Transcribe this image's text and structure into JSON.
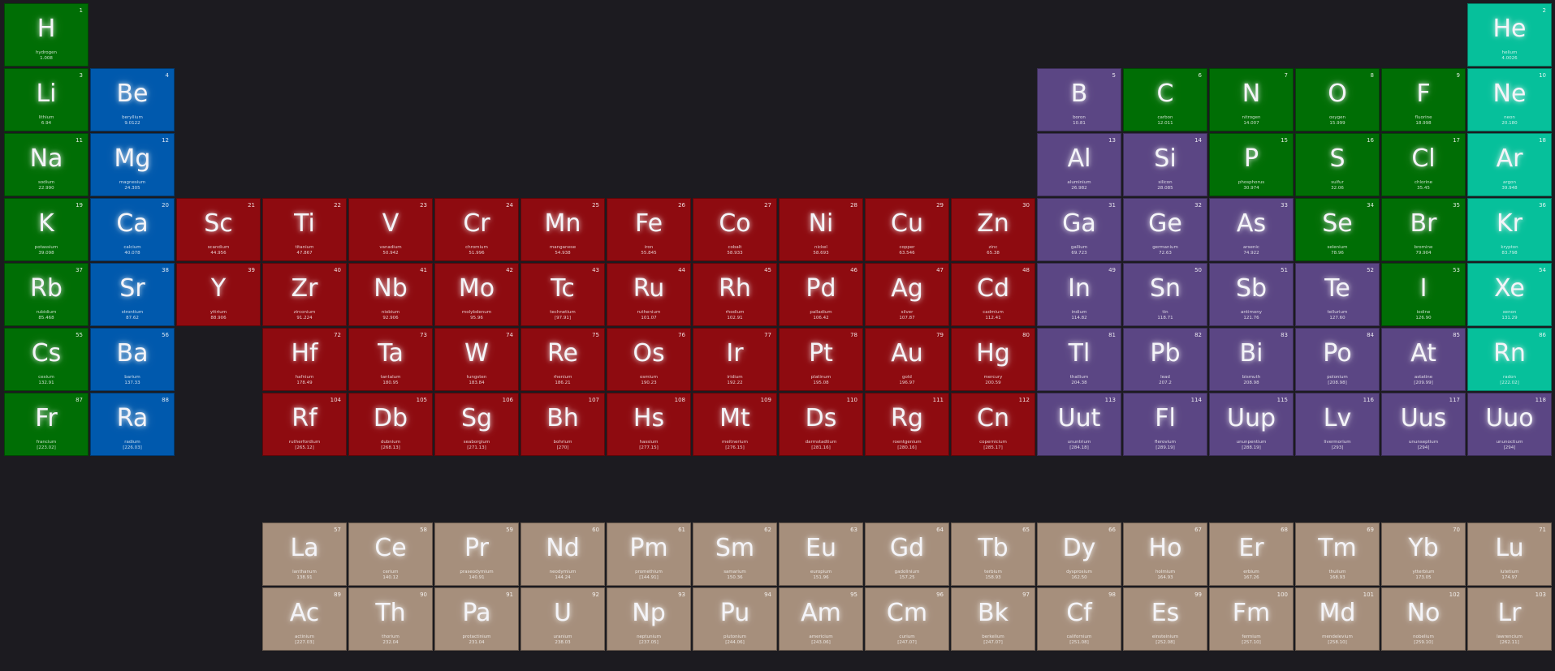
{
  "colors": {
    "background": "#1c1b20",
    "nonmetal": "#006e05",
    "alkaline-earth": "#0059ad",
    "transition": "#8e0b10",
    "metalloid": "#5b4684",
    "noble-gas": "#06c09b",
    "lanthanide": "#a68f7c",
    "actinide": "#a68f7c"
  },
  "elements": [
    {
      "n": "1",
      "sym": "H",
      "name": "hydrogen",
      "mass": "1.008",
      "cat": "nonmetal",
      "row": 1,
      "col": 1
    },
    {
      "n": "2",
      "sym": "He",
      "name": "helium",
      "mass": "4.0026",
      "cat": "noble-gas",
      "row": 1,
      "col": 18
    },
    {
      "n": "3",
      "sym": "Li",
      "name": "lithium",
      "mass": "6.94",
      "cat": "nonmetal",
      "row": 2,
      "col": 1
    },
    {
      "n": "4",
      "sym": "Be",
      "name": "beryllium",
      "mass": "9.0122",
      "cat": "alkaline-earth",
      "row": 2,
      "col": 2
    },
    {
      "n": "5",
      "sym": "B",
      "name": "boron",
      "mass": "10.81",
      "cat": "metalloid",
      "row": 2,
      "col": 13
    },
    {
      "n": "6",
      "sym": "C",
      "name": "carbon",
      "mass": "12.011",
      "cat": "nonmetal",
      "row": 2,
      "col": 14
    },
    {
      "n": "7",
      "sym": "N",
      "name": "nitrogen",
      "mass": "14.007",
      "cat": "nonmetal",
      "row": 2,
      "col": 15
    },
    {
      "n": "8",
      "sym": "O",
      "name": "oxygen",
      "mass": "15.999",
      "cat": "nonmetal",
      "row": 2,
      "col": 16
    },
    {
      "n": "9",
      "sym": "F",
      "name": "fluorine",
      "mass": "18.998",
      "cat": "nonmetal",
      "row": 2,
      "col": 17
    },
    {
      "n": "10",
      "sym": "Ne",
      "name": "neon",
      "mass": "20.180",
      "cat": "noble-gas",
      "row": 2,
      "col": 18
    },
    {
      "n": "11",
      "sym": "Na",
      "name": "sodium",
      "mass": "22.990",
      "cat": "nonmetal",
      "row": 3,
      "col": 1
    },
    {
      "n": "12",
      "sym": "Mg",
      "name": "magnesium",
      "mass": "24.305",
      "cat": "alkaline-earth",
      "row": 3,
      "col": 2
    },
    {
      "n": "13",
      "sym": "Al",
      "name": "aluminium",
      "mass": "26.982",
      "cat": "metalloid",
      "row": 3,
      "col": 13
    },
    {
      "n": "14",
      "sym": "Si",
      "name": "silicon",
      "mass": "28.085",
      "cat": "metalloid",
      "row": 3,
      "col": 14
    },
    {
      "n": "15",
      "sym": "P",
      "name": "phosphorus",
      "mass": "30.974",
      "cat": "nonmetal",
      "row": 3,
      "col": 15
    },
    {
      "n": "16",
      "sym": "S",
      "name": "sulfur",
      "mass": "32.06",
      "cat": "nonmetal",
      "row": 3,
      "col": 16
    },
    {
      "n": "17",
      "sym": "Cl",
      "name": "chlorine",
      "mass": "35.45",
      "cat": "nonmetal",
      "row": 3,
      "col": 17
    },
    {
      "n": "18",
      "sym": "Ar",
      "name": "argon",
      "mass": "39.948",
      "cat": "noble-gas",
      "row": 3,
      "col": 18
    },
    {
      "n": "19",
      "sym": "K",
      "name": "potassium",
      "mass": "39.098",
      "cat": "nonmetal",
      "row": 4,
      "col": 1
    },
    {
      "n": "20",
      "sym": "Ca",
      "name": "calcium",
      "mass": "40.078",
      "cat": "alkaline-earth",
      "row": 4,
      "col": 2
    },
    {
      "n": "21",
      "sym": "Sc",
      "name": "scandium",
      "mass": "44.956",
      "cat": "transition",
      "row": 4,
      "col": 3
    },
    {
      "n": "22",
      "sym": "Ti",
      "name": "titanium",
      "mass": "47.867",
      "cat": "transition",
      "row": 4,
      "col": 4
    },
    {
      "n": "23",
      "sym": "V",
      "name": "vanadium",
      "mass": "50.942",
      "cat": "transition",
      "row": 4,
      "col": 5
    },
    {
      "n": "24",
      "sym": "Cr",
      "name": "chromium",
      "mass": "51.996",
      "cat": "transition",
      "row": 4,
      "col": 6
    },
    {
      "n": "25",
      "sym": "Mn",
      "name": "manganese",
      "mass": "54.938",
      "cat": "transition",
      "row": 4,
      "col": 7
    },
    {
      "n": "26",
      "sym": "Fe",
      "name": "iron",
      "mass": "55.845",
      "cat": "transition",
      "row": 4,
      "col": 8
    },
    {
      "n": "27",
      "sym": "Co",
      "name": "cobalt",
      "mass": "58.933",
      "cat": "transition",
      "row": 4,
      "col": 9
    },
    {
      "n": "28",
      "sym": "Ni",
      "name": "nickel",
      "mass": "58.693",
      "cat": "transition",
      "row": 4,
      "col": 10
    },
    {
      "n": "29",
      "sym": "Cu",
      "name": "copper",
      "mass": "63.546",
      "cat": "transition",
      "row": 4,
      "col": 11
    },
    {
      "n": "30",
      "sym": "Zn",
      "name": "zinc",
      "mass": "65.38",
      "cat": "transition",
      "row": 4,
      "col": 12
    },
    {
      "n": "31",
      "sym": "Ga",
      "name": "gallium",
      "mass": "69.723",
      "cat": "metalloid",
      "row": 4,
      "col": 13
    },
    {
      "n": "32",
      "sym": "Ge",
      "name": "germanium",
      "mass": "72.63",
      "cat": "metalloid",
      "row": 4,
      "col": 14
    },
    {
      "n": "33",
      "sym": "As",
      "name": "arsenic",
      "mass": "74.922",
      "cat": "metalloid",
      "row": 4,
      "col": 15
    },
    {
      "n": "34",
      "sym": "Se",
      "name": "selenium",
      "mass": "78.96",
      "cat": "nonmetal",
      "row": 4,
      "col": 16
    },
    {
      "n": "35",
      "sym": "Br",
      "name": "bromine",
      "mass": "79.904",
      "cat": "nonmetal",
      "row": 4,
      "col": 17
    },
    {
      "n": "36",
      "sym": "Kr",
      "name": "krypton",
      "mass": "83.798",
      "cat": "noble-gas",
      "row": 4,
      "col": 18
    },
    {
      "n": "37",
      "sym": "Rb",
      "name": "rubidium",
      "mass": "85.468",
      "cat": "nonmetal",
      "row": 5,
      "col": 1
    },
    {
      "n": "38",
      "sym": "Sr",
      "name": "strontium",
      "mass": "87.62",
      "cat": "alkaline-earth",
      "row": 5,
      "col": 2
    },
    {
      "n": "39",
      "sym": "Y",
      "name": "yttrium",
      "mass": "88.906",
      "cat": "transition",
      "row": 5,
      "col": 3
    },
    {
      "n": "40",
      "sym": "Zr",
      "name": "zirconium",
      "mass": "91.224",
      "cat": "transition",
      "row": 5,
      "col": 4
    },
    {
      "n": "41",
      "sym": "Nb",
      "name": "niobium",
      "mass": "92.906",
      "cat": "transition",
      "row": 5,
      "col": 5
    },
    {
      "n": "42",
      "sym": "Mo",
      "name": "molybdenum",
      "mass": "95.96",
      "cat": "transition",
      "row": 5,
      "col": 6
    },
    {
      "n": "43",
      "sym": "Tc",
      "name": "technetium",
      "mass": "[97.91]",
      "cat": "transition",
      "row": 5,
      "col": 7
    },
    {
      "n": "44",
      "sym": "Ru",
      "name": "ruthenium",
      "mass": "101.07",
      "cat": "transition",
      "row": 5,
      "col": 8
    },
    {
      "n": "45",
      "sym": "Rh",
      "name": "rhodium",
      "mass": "102.91",
      "cat": "transition",
      "row": 5,
      "col": 9
    },
    {
      "n": "46",
      "sym": "Pd",
      "name": "palladium",
      "mass": "106.42",
      "cat": "transition",
      "row": 5,
      "col": 10
    },
    {
      "n": "47",
      "sym": "Ag",
      "name": "silver",
      "mass": "107.87",
      "cat": "transition",
      "row": 5,
      "col": 11
    },
    {
      "n": "48",
      "sym": "Cd",
      "name": "cadmium",
      "mass": "112.41",
      "cat": "transition",
      "row": 5,
      "col": 12
    },
    {
      "n": "49",
      "sym": "In",
      "name": "indium",
      "mass": "114.82",
      "cat": "metalloid",
      "row": 5,
      "col": 13
    },
    {
      "n": "50",
      "sym": "Sn",
      "name": "tin",
      "mass": "118.71",
      "cat": "metalloid",
      "row": 5,
      "col": 14
    },
    {
      "n": "51",
      "sym": "Sb",
      "name": "antimony",
      "mass": "121.76",
      "cat": "metalloid",
      "row": 5,
      "col": 15
    },
    {
      "n": "52",
      "sym": "Te",
      "name": "tellurium",
      "mass": "127.60",
      "cat": "metalloid",
      "row": 5,
      "col": 16
    },
    {
      "n": "53",
      "sym": "I",
      "name": "iodine",
      "mass": "126.90",
      "cat": "nonmetal",
      "row": 5,
      "col": 17
    },
    {
      "n": "54",
      "sym": "Xe",
      "name": "xenon",
      "mass": "131.29",
      "cat": "noble-gas",
      "row": 5,
      "col": 18
    },
    {
      "n": "55",
      "sym": "Cs",
      "name": "cesium",
      "mass": "132.91",
      "cat": "nonmetal",
      "row": 6,
      "col": 1
    },
    {
      "n": "56",
      "sym": "Ba",
      "name": "barium",
      "mass": "137.33",
      "cat": "alkaline-earth",
      "row": 6,
      "col": 2
    },
    {
      "n": "72",
      "sym": "Hf",
      "name": "hafnium",
      "mass": "178.49",
      "cat": "transition",
      "row": 6,
      "col": 4
    },
    {
      "n": "73",
      "sym": "Ta",
      "name": "tantalum",
      "mass": "180.95",
      "cat": "transition",
      "row": 6,
      "col": 5
    },
    {
      "n": "74",
      "sym": "W",
      "name": "tungsten",
      "mass": "183.84",
      "cat": "transition",
      "row": 6,
      "col": 6
    },
    {
      "n": "75",
      "sym": "Re",
      "name": "rhenium",
      "mass": "186.21",
      "cat": "transition",
      "row": 6,
      "col": 7
    },
    {
      "n": "76",
      "sym": "Os",
      "name": "osmium",
      "mass": "190.23",
      "cat": "transition",
      "row": 6,
      "col": 8
    },
    {
      "n": "77",
      "sym": "Ir",
      "name": "iridium",
      "mass": "192.22",
      "cat": "transition",
      "row": 6,
      "col": 9
    },
    {
      "n": "78",
      "sym": "Pt",
      "name": "platinum",
      "mass": "195.08",
      "cat": "transition",
      "row": 6,
      "col": 10
    },
    {
      "n": "79",
      "sym": "Au",
      "name": "gold",
      "mass": "196.97",
      "cat": "transition",
      "row": 6,
      "col": 11
    },
    {
      "n": "80",
      "sym": "Hg",
      "name": "mercury",
      "mass": "200.59",
      "cat": "transition",
      "row": 6,
      "col": 12
    },
    {
      "n": "81",
      "sym": "Tl",
      "name": "thallium",
      "mass": "204.38",
      "cat": "metalloid",
      "row": 6,
      "col": 13
    },
    {
      "n": "82",
      "sym": "Pb",
      "name": "lead",
      "mass": "207.2",
      "cat": "metalloid",
      "row": 6,
      "col": 14
    },
    {
      "n": "83",
      "sym": "Bi",
      "name": "bismuth",
      "mass": "208.98",
      "cat": "metalloid",
      "row": 6,
      "col": 15
    },
    {
      "n": "84",
      "sym": "Po",
      "name": "polonium",
      "mass": "[208.98]",
      "cat": "metalloid",
      "row": 6,
      "col": 16
    },
    {
      "n": "85",
      "sym": "At",
      "name": "astatine",
      "mass": "[209.99]",
      "cat": "metalloid",
      "row": 6,
      "col": 17
    },
    {
      "n": "86",
      "sym": "Rn",
      "name": "radon",
      "mass": "[222.02]",
      "cat": "noble-gas",
      "row": 6,
      "col": 18
    },
    {
      "n": "87",
      "sym": "Fr",
      "name": "francium",
      "mass": "[223.02]",
      "cat": "nonmetal",
      "row": 7,
      "col": 1
    },
    {
      "n": "88",
      "sym": "Ra",
      "name": "radium",
      "mass": "[226.03]",
      "cat": "alkaline-earth",
      "row": 7,
      "col": 2
    },
    {
      "n": "104",
      "sym": "Rf",
      "name": "rutherfordium",
      "mass": "[265.12]",
      "cat": "transition",
      "row": 7,
      "col": 4
    },
    {
      "n": "105",
      "sym": "Db",
      "name": "dubnium",
      "mass": "[268.13]",
      "cat": "transition",
      "row": 7,
      "col": 5
    },
    {
      "n": "106",
      "sym": "Sg",
      "name": "seaborgium",
      "mass": "[271.13]",
      "cat": "transition",
      "row": 7,
      "col": 6
    },
    {
      "n": "107",
      "sym": "Bh",
      "name": "bohrium",
      "mass": "[270]",
      "cat": "transition",
      "row": 7,
      "col": 7
    },
    {
      "n": "108",
      "sym": "Hs",
      "name": "hassium",
      "mass": "[277.15]",
      "cat": "transition",
      "row": 7,
      "col": 8
    },
    {
      "n": "109",
      "sym": "Mt",
      "name": "meitnerium",
      "mass": "[276.15]",
      "cat": "transition",
      "row": 7,
      "col": 9
    },
    {
      "n": "110",
      "sym": "Ds",
      "name": "darmstadtium",
      "mass": "[281.16]",
      "cat": "transition",
      "row": 7,
      "col": 10
    },
    {
      "n": "111",
      "sym": "Rg",
      "name": "roentgenium",
      "mass": "[280.16]",
      "cat": "transition",
      "row": 7,
      "col": 11
    },
    {
      "n": "112",
      "sym": "Cn",
      "name": "copernicium",
      "mass": "[285.17]",
      "cat": "transition",
      "row": 7,
      "col": 12
    },
    {
      "n": "113",
      "sym": "Uut",
      "name": "ununtrium",
      "mass": "[284.18]",
      "cat": "metalloid",
      "row": 7,
      "col": 13
    },
    {
      "n": "114",
      "sym": "Fl",
      "name": "flerovium",
      "mass": "[289.19]",
      "cat": "metalloid",
      "row": 7,
      "col": 14
    },
    {
      "n": "115",
      "sym": "Uup",
      "name": "ununpentium",
      "mass": "[288.19]",
      "cat": "metalloid",
      "row": 7,
      "col": 15
    },
    {
      "n": "116",
      "sym": "Lv",
      "name": "livermorium",
      "mass": "[293]",
      "cat": "metalloid",
      "row": 7,
      "col": 16
    },
    {
      "n": "117",
      "sym": "Uus",
      "name": "ununseptium",
      "mass": "[294]",
      "cat": "metalloid",
      "row": 7,
      "col": 17
    },
    {
      "n": "118",
      "sym": "Uuo",
      "name": "ununoctium",
      "mass": "[294]",
      "cat": "metalloid",
      "row": 7,
      "col": 18
    },
    {
      "n": "57",
      "sym": "La",
      "name": "lanthanum",
      "mass": "138.91",
      "cat": "lanthanide",
      "row": 9,
      "col": 4
    },
    {
      "n": "58",
      "sym": "Ce",
      "name": "cerium",
      "mass": "140.12",
      "cat": "lanthanide",
      "row": 9,
      "col": 5
    },
    {
      "n": "59",
      "sym": "Pr",
      "name": "praseodymium",
      "mass": "140.91",
      "cat": "lanthanide",
      "row": 9,
      "col": 6
    },
    {
      "n": "60",
      "sym": "Nd",
      "name": "neodymium",
      "mass": "144.24",
      "cat": "lanthanide",
      "row": 9,
      "col": 7
    },
    {
      "n": "61",
      "sym": "Pm",
      "name": "promethium",
      "mass": "[144.91]",
      "cat": "lanthanide",
      "row": 9,
      "col": 8
    },
    {
      "n": "62",
      "sym": "Sm",
      "name": "samarium",
      "mass": "150.36",
      "cat": "lanthanide",
      "row": 9,
      "col": 9
    },
    {
      "n": "63",
      "sym": "Eu",
      "name": "europium",
      "mass": "151.96",
      "cat": "lanthanide",
      "row": 9,
      "col": 10
    },
    {
      "n": "64",
      "sym": "Gd",
      "name": "gadolinium",
      "mass": "157.25",
      "cat": "lanthanide",
      "row": 9,
      "col": 11
    },
    {
      "n": "65",
      "sym": "Tb",
      "name": "terbium",
      "mass": "158.93",
      "cat": "lanthanide",
      "row": 9,
      "col": 12
    },
    {
      "n": "66",
      "sym": "Dy",
      "name": "dysprosium",
      "mass": "162.50",
      "cat": "lanthanide",
      "row": 9,
      "col": 13
    },
    {
      "n": "67",
      "sym": "Ho",
      "name": "holmium",
      "mass": "164.93",
      "cat": "lanthanide",
      "row": 9,
      "col": 14
    },
    {
      "n": "68",
      "sym": "Er",
      "name": "erbium",
      "mass": "167.26",
      "cat": "lanthanide",
      "row": 9,
      "col": 15
    },
    {
      "n": "69",
      "sym": "Tm",
      "name": "thulium",
      "mass": "168.93",
      "cat": "lanthanide",
      "row": 9,
      "col": 16
    },
    {
      "n": "70",
      "sym": "Yb",
      "name": "ytterbium",
      "mass": "173.05",
      "cat": "lanthanide",
      "row": 9,
      "col": 17
    },
    {
      "n": "71",
      "sym": "Lu",
      "name": "lutetium",
      "mass": "174.97",
      "cat": "lanthanide",
      "row": 9,
      "col": 18
    },
    {
      "n": "89",
      "sym": "Ac",
      "name": "actinium",
      "mass": "[227.03]",
      "cat": "actinide",
      "row": 10,
      "col": 4
    },
    {
      "n": "90",
      "sym": "Th",
      "name": "thorium",
      "mass": "232.04",
      "cat": "actinide",
      "row": 10,
      "col": 5
    },
    {
      "n": "91",
      "sym": "Pa",
      "name": "protactinium",
      "mass": "231.04",
      "cat": "actinide",
      "row": 10,
      "col": 6
    },
    {
      "n": "92",
      "sym": "U",
      "name": "uranium",
      "mass": "238.03",
      "cat": "actinide",
      "row": 10,
      "col": 7
    },
    {
      "n": "93",
      "sym": "Np",
      "name": "neptunium",
      "mass": "[237.05]",
      "cat": "actinide",
      "row": 10,
      "col": 8
    },
    {
      "n": "94",
      "sym": "Pu",
      "name": "plutonium",
      "mass": "[244.06]",
      "cat": "actinide",
      "row": 10,
      "col": 9
    },
    {
      "n": "95",
      "sym": "Am",
      "name": "americium",
      "mass": "[243.06]",
      "cat": "actinide",
      "row": 10,
      "col": 10
    },
    {
      "n": "96",
      "sym": "Cm",
      "name": "curium",
      "mass": "[247.07]",
      "cat": "actinide",
      "row": 10,
      "col": 11
    },
    {
      "n": "97",
      "sym": "Bk",
      "name": "berkelium",
      "mass": "[247.07]",
      "cat": "actinide",
      "row": 10,
      "col": 12
    },
    {
      "n": "98",
      "sym": "Cf",
      "name": "californium",
      "mass": "[251.08]",
      "cat": "actinide",
      "row": 10,
      "col": 13
    },
    {
      "n": "99",
      "sym": "Es",
      "name": "einsteinium",
      "mass": "[252.08]",
      "cat": "actinide",
      "row": 10,
      "col": 14
    },
    {
      "n": "100",
      "sym": "Fm",
      "name": "fermium",
      "mass": "[257.10]",
      "cat": "actinide",
      "row": 10,
      "col": 15
    },
    {
      "n": "101",
      "sym": "Md",
      "name": "mendelevium",
      "mass": "[258.10]",
      "cat": "actinide",
      "row": 10,
      "col": 16
    },
    {
      "n": "102",
      "sym": "No",
      "name": "nobelium",
      "mass": "[259.10]",
      "cat": "actinide",
      "row": 10,
      "col": 17
    },
    {
      "n": "103",
      "sym": "Lr",
      "name": "lawrencium",
      "mass": "[262.11]",
      "cat": "actinide",
      "row": 10,
      "col": 18
    }
  ]
}
